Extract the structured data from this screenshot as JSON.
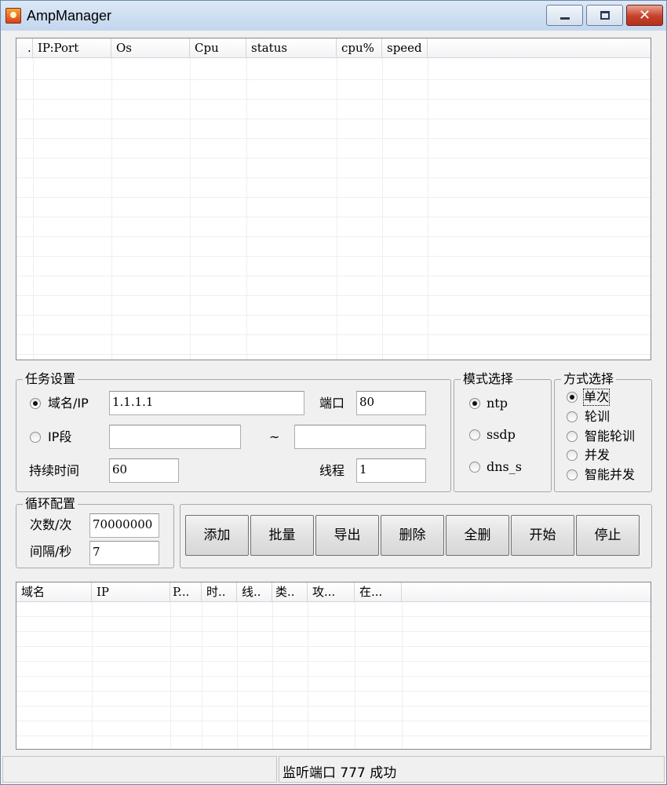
{
  "window": {
    "title": "AmpManager"
  },
  "server_list": {
    "columns": [
      ".",
      "IP:Port",
      "Os",
      "Cpu",
      "status",
      "cpu%",
      "speed"
    ]
  },
  "task_settings": {
    "title": "任务设置",
    "domain_ip_label": "域名/IP",
    "domain_ip_value": "1.1.1.1",
    "port_label": "端口",
    "port_value": "80",
    "ip_range_label": "IP段",
    "ip_range_start": "",
    "ip_range_sep": "~",
    "ip_range_end": "",
    "duration_label": "持续时间",
    "duration_value": "60",
    "threads_label": "线程",
    "threads_value": "1"
  },
  "mode_select": {
    "title": "模式选择",
    "options": [
      "ntp",
      "ssdp",
      "dns_s"
    ],
    "selected": "ntp"
  },
  "method_select": {
    "title": "方式选择",
    "options": [
      "单次",
      "轮训",
      "智能轮训",
      "并发",
      "智能并发"
    ],
    "selected": "单次"
  },
  "loop_config": {
    "title": "循环配置",
    "count_label": "次数/次",
    "count_value": "70000000",
    "interval_label": "间隔/秒",
    "interval_value": "7"
  },
  "actions": {
    "add": "添加",
    "batch": "批量",
    "export": "导出",
    "delete": "删除",
    "delete_all": "全删",
    "start": "开始",
    "stop": "停止"
  },
  "task_list": {
    "columns": [
      "域名",
      "IP",
      "P...",
      "时..",
      "线..",
      "类..",
      "攻...",
      "在..."
    ]
  },
  "status_bar": {
    "left": "",
    "message": "监听端口 777 成功"
  }
}
